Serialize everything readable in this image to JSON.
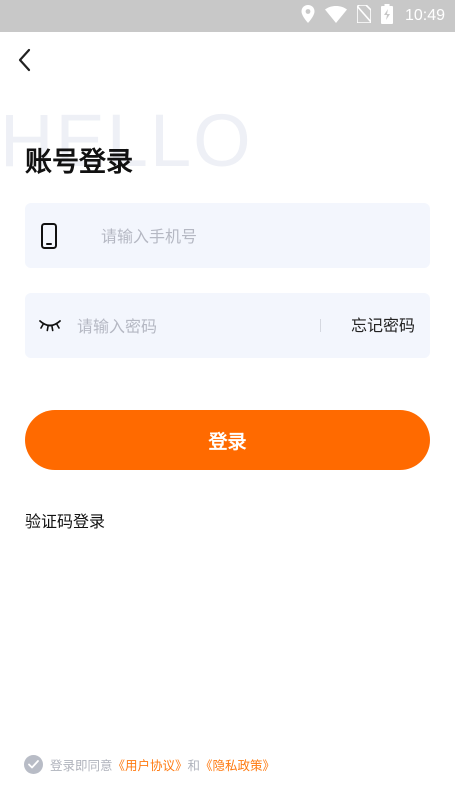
{
  "status_bar": {
    "time": "10:49",
    "icons": [
      "location-icon",
      "wifi-icon",
      "no-sim-icon",
      "battery-charging-icon"
    ]
  },
  "header": {
    "back_icon": "chevron-left-icon"
  },
  "watermark": "HELLO",
  "title": "账号登录",
  "phone_field": {
    "icon": "phone-icon",
    "placeholder": "请输入手机号",
    "value": ""
  },
  "password_field": {
    "icon": "eye-closed-icon",
    "placeholder": "请输入密码",
    "value": "",
    "forgot_label": "忘记密码"
  },
  "login_button": {
    "label": "登录"
  },
  "alt_login": {
    "label": "验证码登录"
  },
  "agreement": {
    "prefix": "登录即同意",
    "user_agreement": "《用户协议》",
    "and": "和",
    "privacy_policy": "《隐私政策》"
  },
  "colors": {
    "accent": "#ff6a00",
    "input_bg": "#f3f6fd",
    "status_bar": "#c8c8c8",
    "link": "#ff7a10"
  }
}
